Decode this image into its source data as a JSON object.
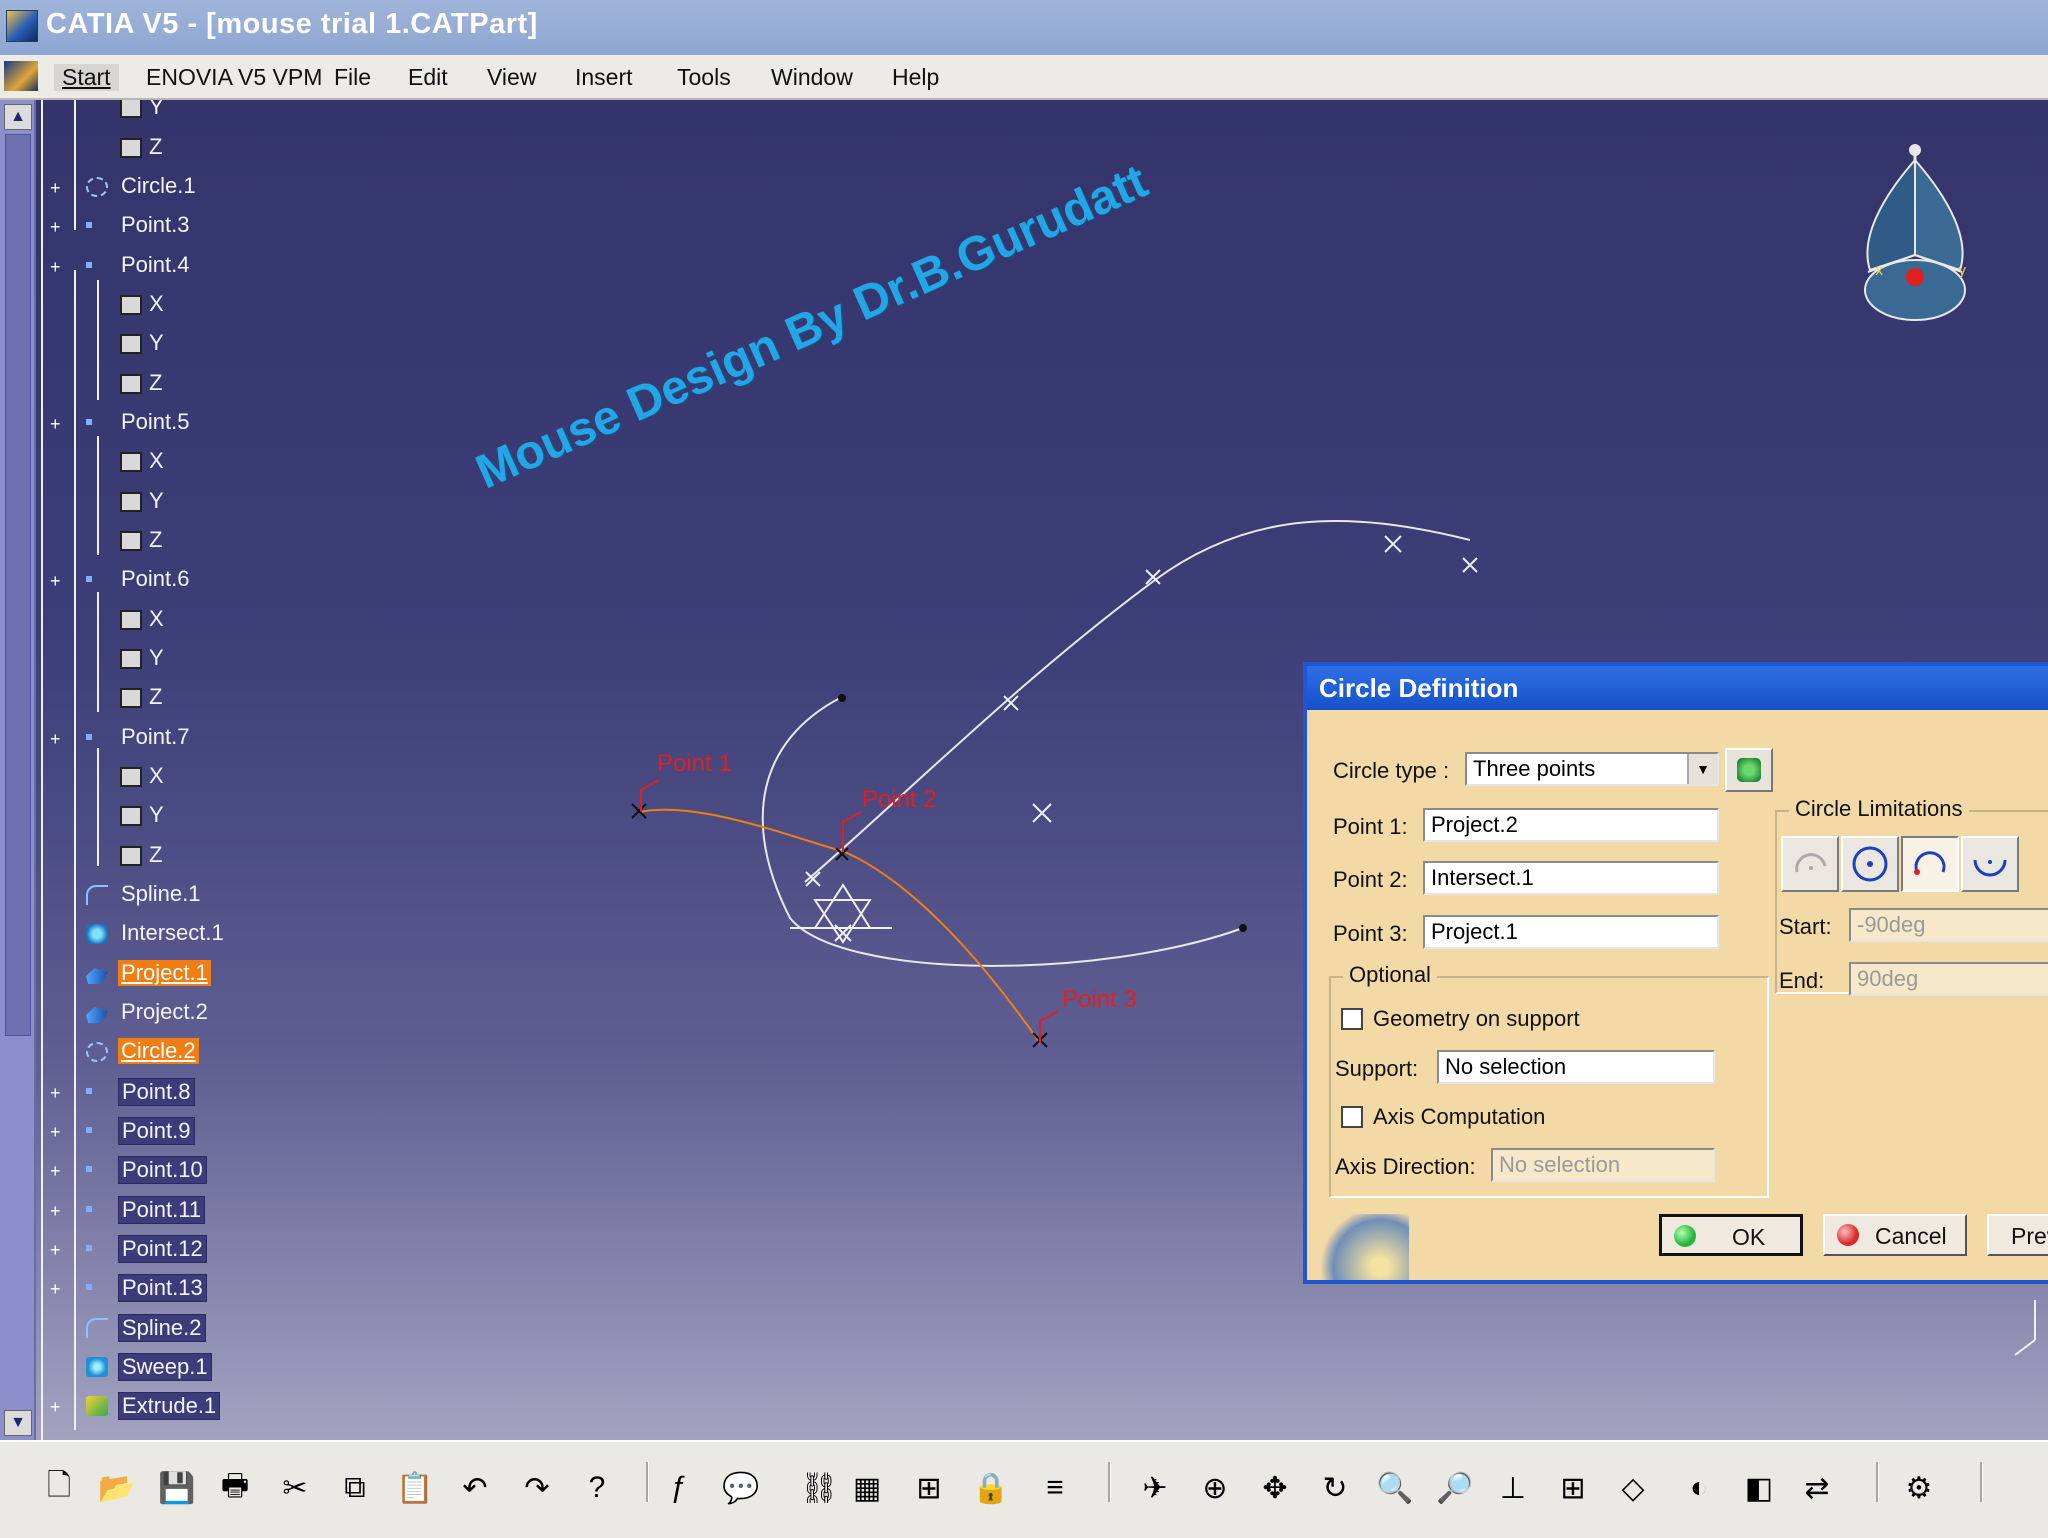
{
  "window": {
    "title": "CATIA V5 - [mouse trial 1.CATPart]"
  },
  "menu": {
    "items": [
      "Start",
      "ENOVIA V5 VPM",
      "File",
      "Edit",
      "View",
      "Insert",
      "Tools",
      "Window",
      "Help"
    ]
  },
  "tree": {
    "nodes": [
      {
        "label": "Y",
        "kind": "param"
      },
      {
        "label": "Z",
        "kind": "param"
      },
      {
        "label": "Circle.1",
        "kind": "circle",
        "expandable": true
      },
      {
        "label": "Point.3",
        "kind": "point",
        "expandable": true
      },
      {
        "label": "Point.4",
        "kind": "point",
        "expandable": true
      },
      {
        "label": "X",
        "kind": "param"
      },
      {
        "label": "Y",
        "kind": "param"
      },
      {
        "label": "Z",
        "kind": "param"
      },
      {
        "label": "Point.5",
        "kind": "point",
        "expandable": true
      },
      {
        "label": "X",
        "kind": "param"
      },
      {
        "label": "Y",
        "kind": "param"
      },
      {
        "label": "Z",
        "kind": "param"
      },
      {
        "label": "Point.6",
        "kind": "point",
        "expandable": true
      },
      {
        "label": "X",
        "kind": "param"
      },
      {
        "label": "Y",
        "kind": "param"
      },
      {
        "label": "Z",
        "kind": "param"
      },
      {
        "label": "Point.7",
        "kind": "point",
        "expandable": true
      },
      {
        "label": "X",
        "kind": "param"
      },
      {
        "label": "Y",
        "kind": "param"
      },
      {
        "label": "Z",
        "kind": "param"
      },
      {
        "label": "Spline.1",
        "kind": "curve"
      },
      {
        "label": "Intersect.1",
        "kind": "intersect"
      },
      {
        "label": "Project.1",
        "kind": "project",
        "selected": true
      },
      {
        "label": "Project.2",
        "kind": "project"
      },
      {
        "label": "Circle.2",
        "kind": "circle",
        "selected": true
      },
      {
        "label": "Point.8",
        "kind": "point",
        "expandable": true,
        "boxed": true
      },
      {
        "label": "Point.9",
        "kind": "point",
        "expandable": true,
        "boxed": true
      },
      {
        "label": "Point.10",
        "kind": "point",
        "expandable": true,
        "boxed": true
      },
      {
        "label": "Point.11",
        "kind": "point",
        "expandable": true,
        "boxed": true
      },
      {
        "label": "Point.12",
        "kind": "point",
        "expandable": true,
        "boxed": true
      },
      {
        "label": "Point.13",
        "kind": "point",
        "expandable": true,
        "boxed": true
      },
      {
        "label": "Spline.2",
        "kind": "curve",
        "boxed": true
      },
      {
        "label": "Sweep.1",
        "kind": "sweep",
        "boxed": true
      },
      {
        "label": "Extrude.1",
        "kind": "extrude",
        "expandable": true,
        "boxed": true
      }
    ]
  },
  "viewport": {
    "watermark": "Mouse Design By Dr.B.Gurudatt",
    "point_labels": [
      "Point 1",
      "Point 2",
      "Point 3"
    ],
    "compass_icon": "compass-icon"
  },
  "dialog": {
    "title": "Circle Definition",
    "circle_type_label": "Circle type :",
    "circle_type_value": "Three points",
    "point1_label": "Point 1:",
    "point1_value": "Project.2",
    "point2_label": "Point 2:",
    "point2_value": "Intersect.1",
    "point3_label": "Point 3:",
    "point3_value": "Project.1",
    "optional_caption": "Optional",
    "geometry_on_support_label": "Geometry on support",
    "support_label": "Support:",
    "support_value": "No selection",
    "axis_computation_label": "Axis Computation",
    "axis_direction_label": "Axis Direction:",
    "axis_direction_value": "No selection",
    "limitations_caption": "Circle Limitations",
    "start_label": "Start:",
    "start_value": "-90deg",
    "end_label": "End:",
    "end_value": "90deg",
    "ok_label": "OK",
    "cancel_label": "Cancel",
    "preview_label": "Prev",
    "ok_dot_color": "#22b83a",
    "cancel_dot_color": "#d82a2a"
  },
  "colors": {
    "selection": "#f07e14",
    "watermark": "#24a6e6",
    "dialog_title": "#1e57d0",
    "point_label": "#e02020"
  },
  "toolbar": {
    "icons": [
      "new-file-icon",
      "open-icon",
      "save-icon",
      "print-icon",
      "cut-icon",
      "copy-icon",
      "paste-icon",
      "undo-icon",
      "redo-icon",
      "whats-this-icon",
      "formula-icon",
      "comment-icon",
      "link-icon",
      "table-icon",
      "tree-icon",
      "lock-icon",
      "equation-icon",
      "fly-icon",
      "fit-all-icon",
      "pan-icon",
      "rotate-icon",
      "zoom-in-icon",
      "zoom-out-icon",
      "normal-view-icon",
      "multi-view-icon",
      "iso-view-icon",
      "shading-icon",
      "hide-show-icon",
      "swap-visible-icon",
      "customize-icon"
    ]
  }
}
